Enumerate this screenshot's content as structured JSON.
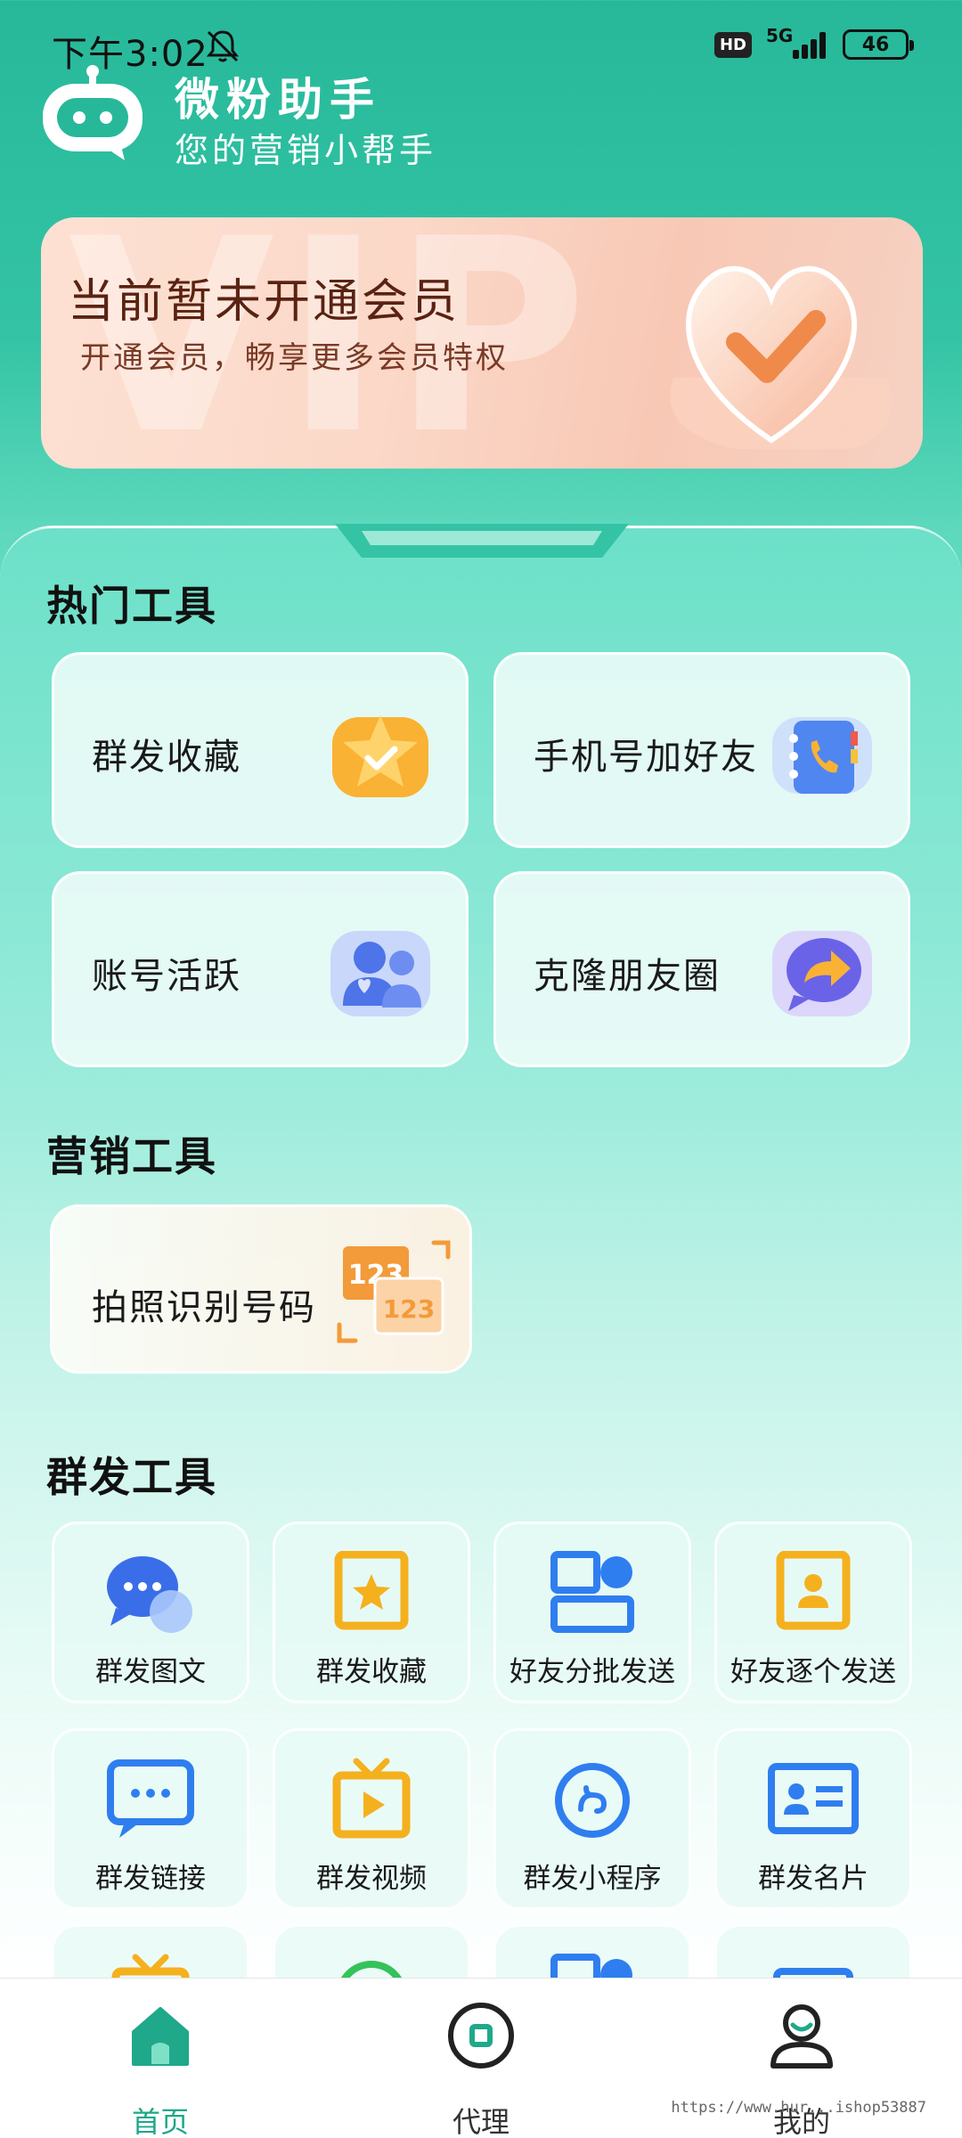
{
  "status_bar": {
    "time": "下午3:02",
    "hd_label": "HD",
    "network_label": "5G",
    "battery_level": "46"
  },
  "header": {
    "title": "微粉助手",
    "subtitle": "您的营销小帮手"
  },
  "vip_banner": {
    "watermark": "VIP",
    "title": "当前暂未开通会员",
    "subtitle": "开通会员，畅享更多会员特权"
  },
  "hot_tools": {
    "title": "热门工具",
    "items": [
      {
        "label": "群发收藏",
        "icon": "star-folder-icon"
      },
      {
        "label": "手机号加好友",
        "icon": "phone-book-icon"
      },
      {
        "label": "账号活跃",
        "icon": "users-icon"
      },
      {
        "label": "克隆朋友圈",
        "icon": "share-arrow-icon"
      }
    ]
  },
  "marketing_tools": {
    "title": "营销工具",
    "items": [
      {
        "label": "拍照识别号码",
        "icon": "scan-number-icon",
        "icon_text_1": "123",
        "icon_text_2": "123"
      }
    ]
  },
  "broadcast_tools": {
    "title": "群发工具",
    "items": [
      {
        "label": "群发图文",
        "icon": "chat-bubbles-icon"
      },
      {
        "label": "群发收藏",
        "icon": "star-frame-icon"
      },
      {
        "label": "好友分批发送",
        "icon": "batch-send-icon"
      },
      {
        "label": "好友逐个发送",
        "icon": "contact-card-icon"
      },
      {
        "label": "群发链接",
        "icon": "message-link-icon"
      },
      {
        "label": "群发视频",
        "icon": "tv-play-icon"
      },
      {
        "label": "群发小程序",
        "icon": "mini-program-icon"
      },
      {
        "label": "群发名片",
        "icon": "business-card-icon"
      }
    ]
  },
  "bottom_nav": {
    "items": [
      {
        "label": "首页",
        "icon": "home-icon",
        "active": true
      },
      {
        "label": "代理",
        "icon": "agent-icon",
        "active": false
      },
      {
        "label": "我的",
        "icon": "profile-icon",
        "active": false
      }
    ]
  },
  "watermark_url": "https://www.hur...ishop53887",
  "colors": {
    "brand_green": "#27b89a",
    "active_nav": "#1fa88a"
  }
}
